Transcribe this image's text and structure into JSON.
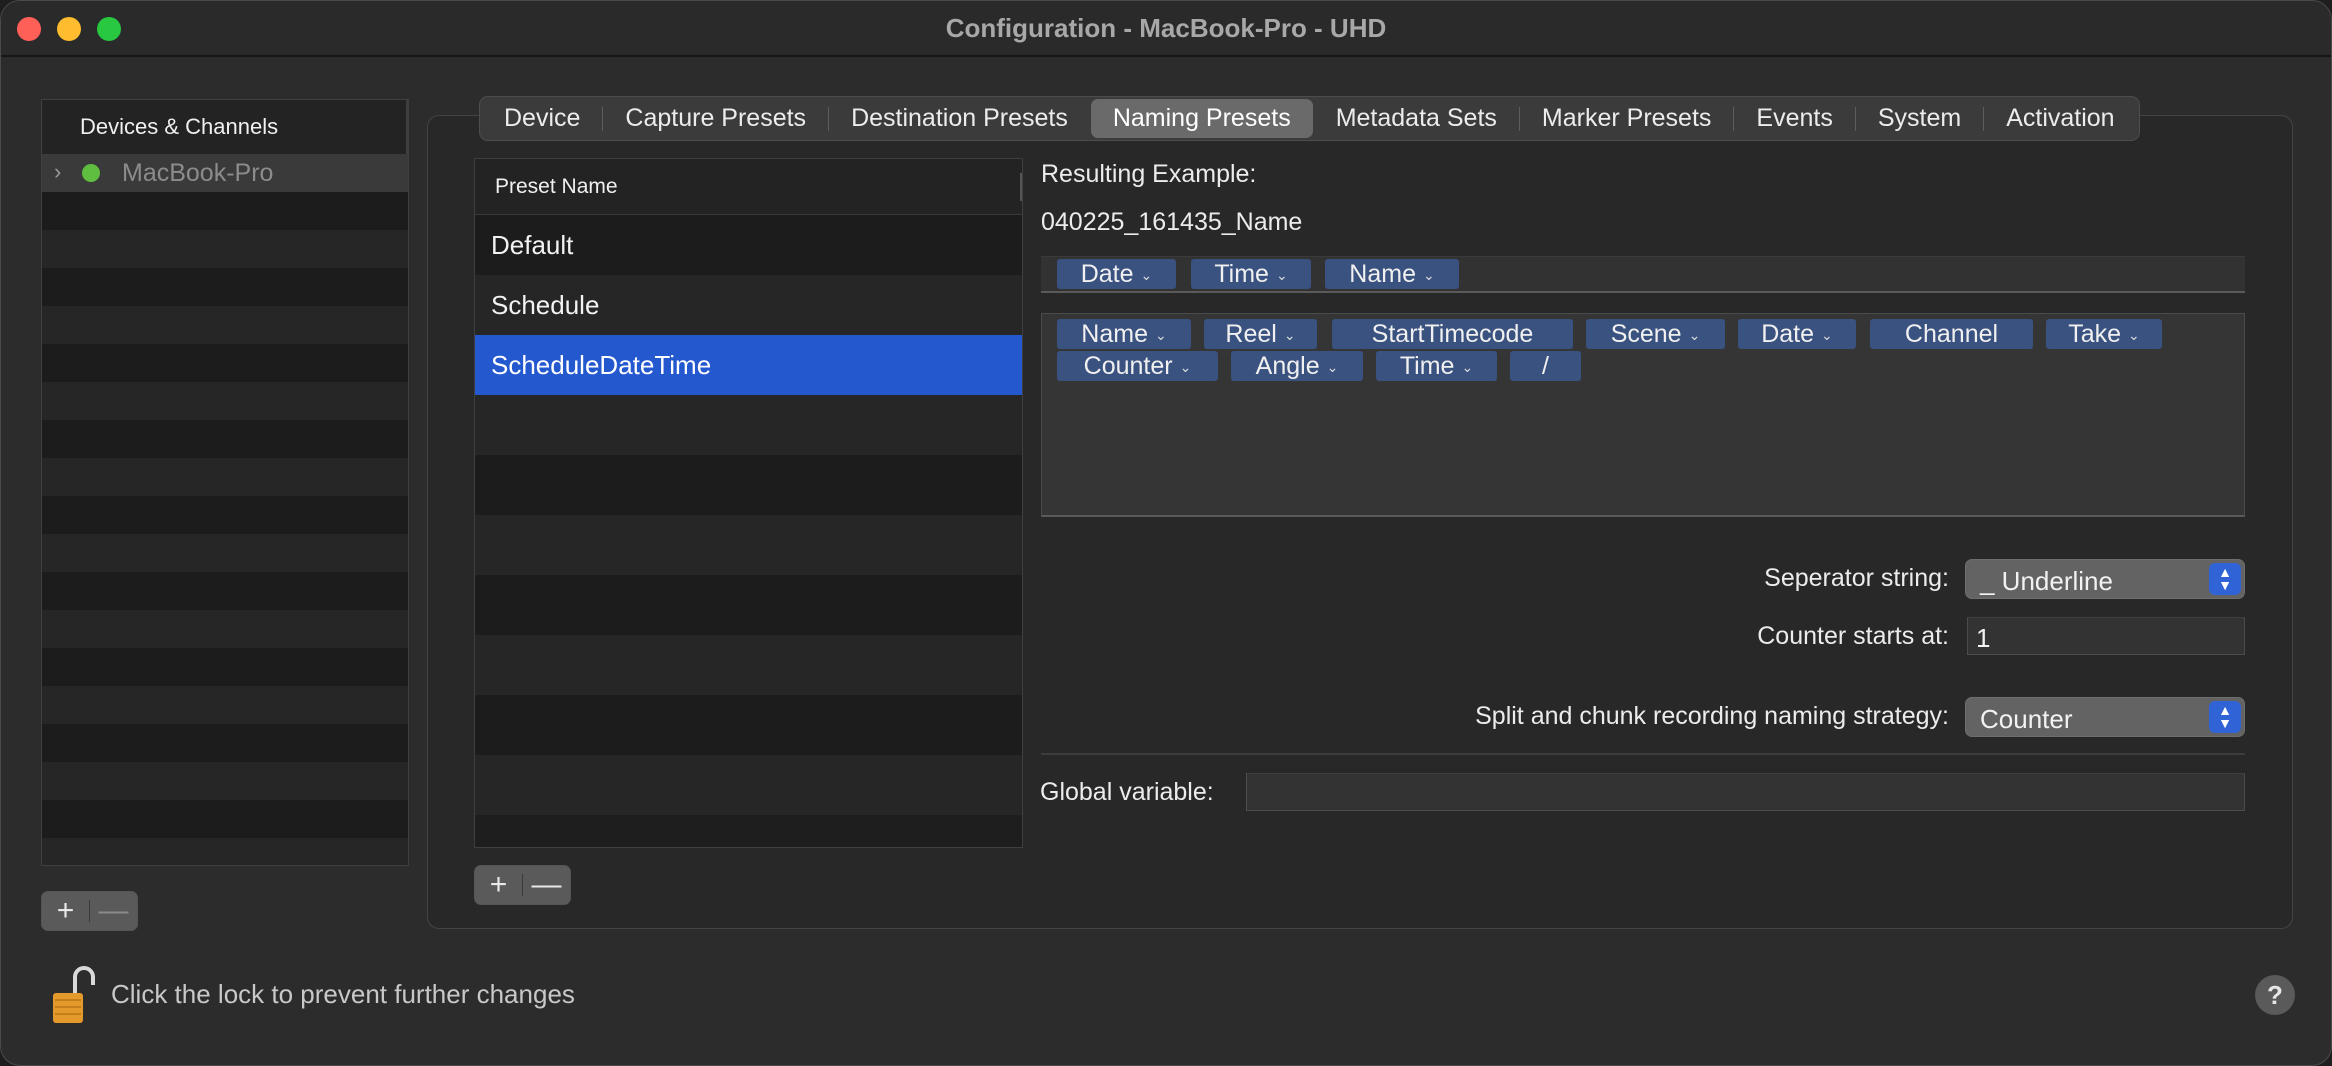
{
  "window": {
    "title": "Configuration - MacBook-Pro - UHD"
  },
  "sidebar": {
    "header": "Devices & Channels",
    "device": {
      "name": "MacBook-Pro",
      "status_color": "#5fbe3f"
    },
    "add_label": "+",
    "remove_label": "—"
  },
  "tabs": [
    "Device",
    "Capture Presets",
    "Destination Presets",
    "Naming Presets",
    "Metadata Sets",
    "Marker Presets",
    "Events",
    "System",
    "Activation"
  ],
  "selected_tab": "Naming Presets",
  "presets": {
    "column_header": "Preset Name",
    "items": [
      "Default",
      "Schedule",
      "ScheduleDateTime"
    ],
    "selected": "ScheduleDateTime",
    "add_label": "+",
    "remove_label": "—"
  },
  "naming": {
    "resulting_label": "Resulting Example:",
    "resulting_value": "040225_161435_Name",
    "active_tokens": [
      "Date",
      "Time",
      "Name"
    ],
    "available_tokens_row1": [
      "Name",
      "Reel",
      "StartTimecode",
      "Scene",
      "Date",
      "Channel",
      "Take"
    ],
    "available_tokens_row2": [
      "Counter",
      "Angle",
      "Time",
      "/"
    ],
    "separator_label": "Seperator string:",
    "separator_value": "_ Underline",
    "counter_label": "Counter starts at:",
    "counter_value": "1",
    "split_label": "Split and chunk recording naming strategy:",
    "split_value": "Counter",
    "global_label": "Global variable:",
    "global_value": ""
  },
  "footer": {
    "lock_text": "Click the lock to prevent further changes",
    "help_label": "?"
  },
  "colors": {
    "selection": "#2458cf",
    "token": "#3a5280",
    "popup_accent": "#2f63d6"
  }
}
